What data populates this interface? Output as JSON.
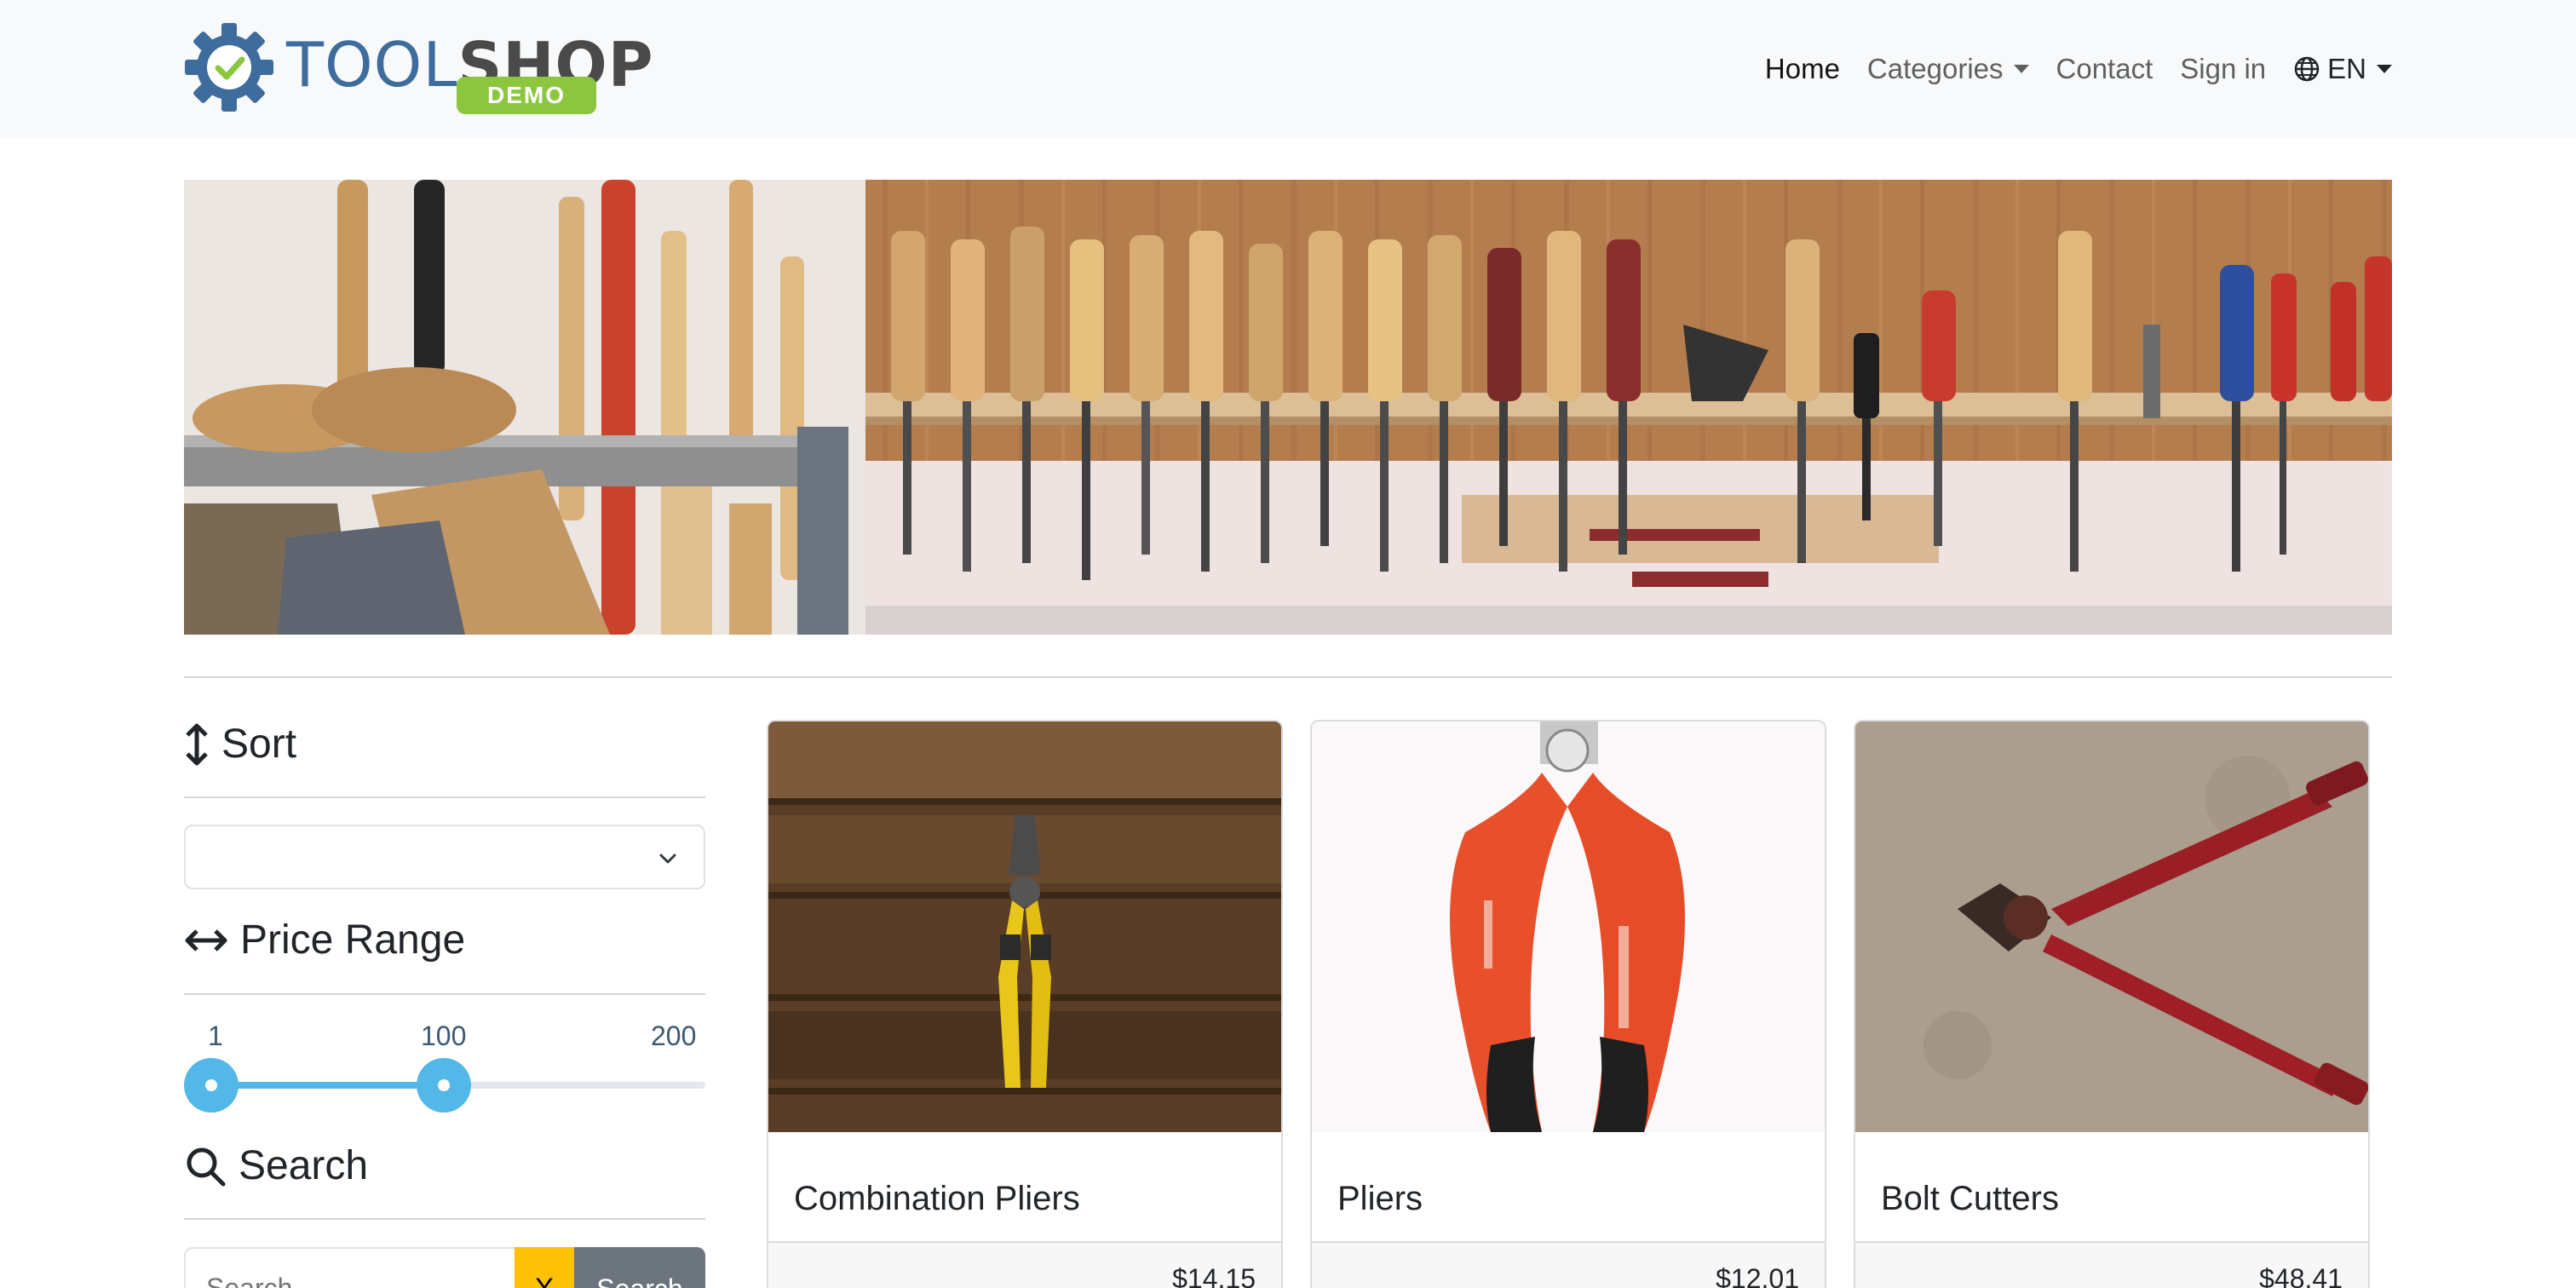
{
  "brand": {
    "word_part1": "TOOL",
    "word_part2": "SHOP",
    "badge": "DEMO"
  },
  "nav": {
    "home": "Home",
    "categories": "Categories",
    "contact": "Contact",
    "signin": "Sign in",
    "language": "EN"
  },
  "sidebar": {
    "sort_heading": "Sort",
    "sort_selected": "",
    "price_heading": "Price Range",
    "price_min_label": "1",
    "price_current_label": "100",
    "price_max_label": "200",
    "price_range": {
      "min": 1,
      "max": 200,
      "low": 1,
      "high": 100
    },
    "search_heading": "Search",
    "search_placeholder": "Search",
    "clear_label": "X",
    "search_button": "Search"
  },
  "products": [
    {
      "name": "Combination Pliers",
      "price": "$14.15"
    },
    {
      "name": "Pliers",
      "price": "$12.01"
    },
    {
      "name": "Bolt Cutters",
      "price": "$48.41"
    }
  ],
  "colors": {
    "navbar_bg": "#f8f9fa",
    "brand_blue": "#3d6c9d",
    "brand_green": "#8cc63f",
    "slider_accent": "#53b7e8",
    "clear_button": "#ffc107",
    "search_button": "#6c757d"
  }
}
